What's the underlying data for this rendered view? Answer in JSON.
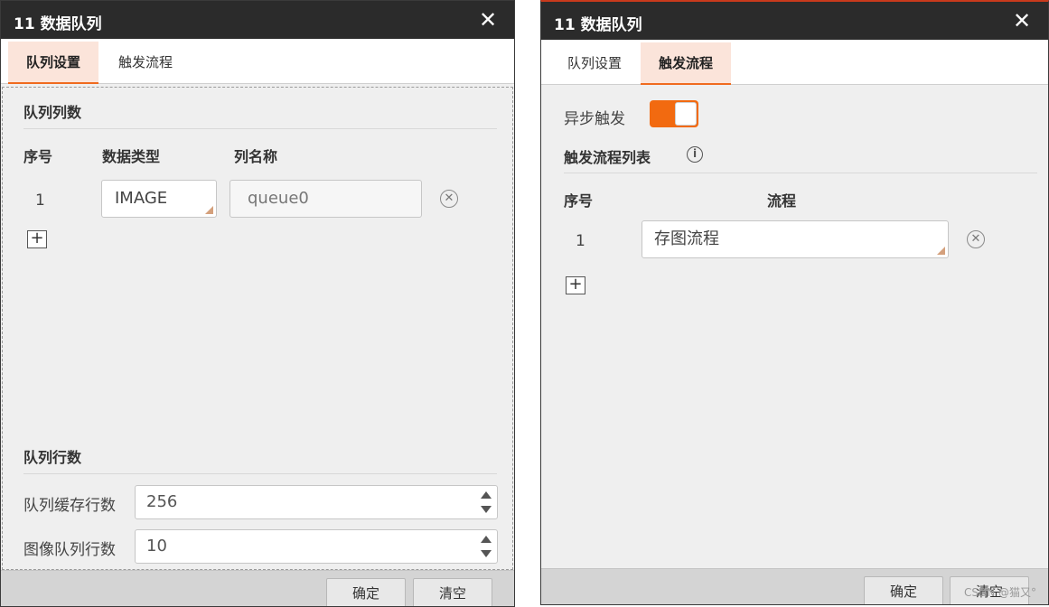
{
  "dialog1": {
    "title": "11 数据队列",
    "tabs": [
      {
        "label": "队列设置",
        "active": true
      },
      {
        "label": "触发流程",
        "active": false
      }
    ],
    "columns_section": {
      "title": "队列列数",
      "headers": {
        "index": "序号",
        "data_type": "数据类型",
        "column_name": "列名称"
      },
      "rows": [
        {
          "index": "1",
          "data_type": "IMAGE",
          "column_name": "queue0"
        }
      ]
    },
    "rows_section": {
      "title": "队列行数",
      "queue_buffer_rows": {
        "label": "队列缓存行数",
        "value": "256"
      },
      "image_queue_rows": {
        "label": "图像队列行数",
        "value": "10"
      }
    },
    "footer": {
      "confirm": "确定",
      "clear": "清空"
    }
  },
  "dialog2": {
    "title": "11 数据队列",
    "tabs": [
      {
        "label": "队列设置",
        "active": false
      },
      {
        "label": "触发流程",
        "active": true
      }
    ],
    "async_trigger": {
      "label": "异步触发",
      "enabled": true
    },
    "trigger_list": {
      "title": "触发流程列表",
      "headers": {
        "index": "序号",
        "flow": "流程"
      },
      "rows": [
        {
          "index": "1",
          "flow": "存图流程"
        }
      ]
    },
    "footer": {
      "confirm": "确定",
      "clear": "清空"
    }
  },
  "watermark": "CSDN @猫又°",
  "icons": {
    "close": "close-icon",
    "remove": "remove-circle-icon",
    "add": "add-square-icon",
    "info": "info-icon"
  },
  "colors": {
    "titlebar": "#2b2b2b",
    "accent": "#f06b1f",
    "active_tab_bg": "#fbe4da",
    "toggle_on": "#f26a10"
  }
}
